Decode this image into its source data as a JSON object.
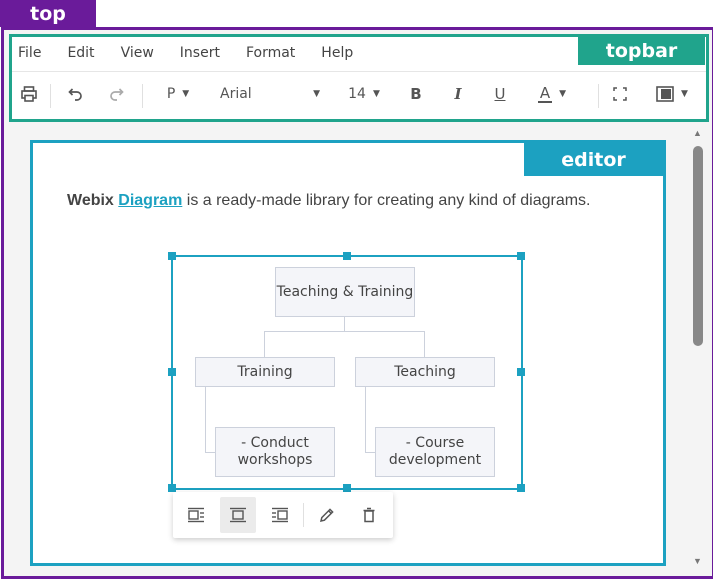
{
  "tags": {
    "top": "top",
    "topbar": "topbar",
    "editor": "editor"
  },
  "menu": [
    "File",
    "Edit",
    "View",
    "Insert",
    "Format",
    "Help"
  ],
  "toolbar": {
    "paragraph": "P",
    "font_family": "Arial",
    "font_size": "14",
    "bold": "B",
    "italic": "I",
    "underline": "U",
    "text_color": "A"
  },
  "content": {
    "brand": "Webix",
    "link_text": "Diagram",
    "rest": " is a ready-made library for creating any kind of diagrams."
  },
  "diagram": {
    "root": "Teaching & Training",
    "left": "Training",
    "right": "Teaching",
    "left_child": "- Conduct workshops",
    "right_child": "- Course development"
  },
  "colors": {
    "top": "#6a1b9a",
    "topbar": "#20a48c",
    "editor": "#1ca1c1"
  }
}
